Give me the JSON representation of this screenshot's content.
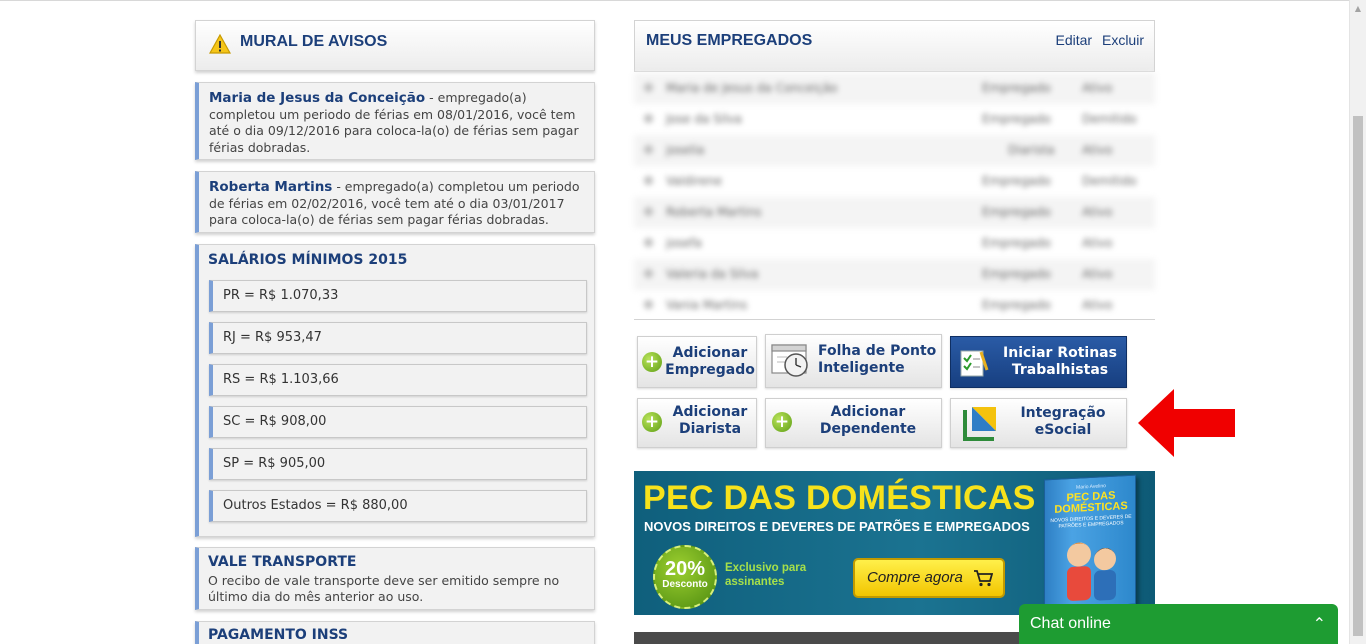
{
  "mural": {
    "title": "MURAL DE AVISOS"
  },
  "notices": [
    {
      "name": "Maria de Jesus da Conceição",
      "text": " - empregado(a) completou um periodo de férias em 08/01/2016, você tem até o dia 09/12/2016 para coloca-la(o) de férias sem pagar férias dobradas."
    },
    {
      "name": "Roberta Martins",
      "text": " - empregado(a) completou um periodo de férias em 02/02/2016, você tem até o dia 03/01/2017 para coloca-la(o) de férias sem pagar férias dobradas."
    }
  ],
  "salarios": {
    "title": "SALÁRIOS MÍNIMOS 2015",
    "items": [
      "PR = R$ 1.070,33",
      "RJ = R$ 953,47",
      "RS = R$ 1.103,66",
      "SC = R$ 908,00",
      "SP = R$ 905,00",
      "Outros Estados = R$ 880,00"
    ]
  },
  "vale": {
    "title": "VALE TRANSPORTE",
    "text": "O recibo de vale transporte deve ser emitido sempre no último dia do mês anterior ao uso."
  },
  "inss": {
    "title": "PAGAMENTO INSS"
  },
  "empregados": {
    "title": "MEUS EMPREGADOS",
    "edit_label": "Editar",
    "delete_label": "Excluir",
    "rows": [
      {
        "name": "Maria de Jesus da Conceição",
        "role": "Empregado",
        "status": "Ativo"
      },
      {
        "name": "Jose da Silva",
        "role": "Empregado",
        "status": "Demitido"
      },
      {
        "name": "joselia",
        "role": "Diarista",
        "status": "Ativo"
      },
      {
        "name": "Valdirene",
        "role": "Empregado",
        "status": "Demitido"
      },
      {
        "name": "Roberta Martins",
        "role": "Empregado",
        "status": "Ativo"
      },
      {
        "name": "josefa",
        "role": "Empregado",
        "status": "Ativo"
      },
      {
        "name": "Valeria da Silva",
        "role": "Empregado",
        "status": "Ativo"
      },
      {
        "name": "Vania Martins",
        "role": "Empregado",
        "status": "Ativo"
      }
    ]
  },
  "actions": {
    "add_employee": {
      "line1": "Adicionar",
      "line2": "Empregado"
    },
    "timesheet": {
      "line1": "Folha de Ponto",
      "line2": "Inteligente"
    },
    "routines": {
      "line1": "Iniciar Rotinas",
      "line2": "Trabalhistas"
    },
    "add_diarist": {
      "line1": "Adicionar",
      "line2": "Diarista"
    },
    "add_dependent": {
      "line1": "Adicionar",
      "line2": "Dependente"
    },
    "esocial": {
      "line1": "Integração",
      "line2": "eSocial"
    }
  },
  "banner": {
    "title": "PEC DAS DOMÉSTICAS",
    "subtitle": "NOVOS DIREITOS E DEVERES DE PATRÕES E EMPREGADOS",
    "discount_pct": "20%",
    "discount_label": "Desconto",
    "exclusive": "Exclusivo para assinantes",
    "buy_label": "Compre agora",
    "book_author": "Mario Avelino",
    "book_title_1": "PEC DAS",
    "book_title_2": "DOMÉSTICAS",
    "book_sub": "NOVOS DIREITOS E DEVERES DE PATRÕES E EMPREGADOS"
  },
  "chat": {
    "label": "Chat online"
  },
  "colors": {
    "brand_blue": "#1c3f7a",
    "accent_blue": "#7b9fd6",
    "chat_green": "#1e9c32",
    "arrow_red": "#f00000"
  }
}
